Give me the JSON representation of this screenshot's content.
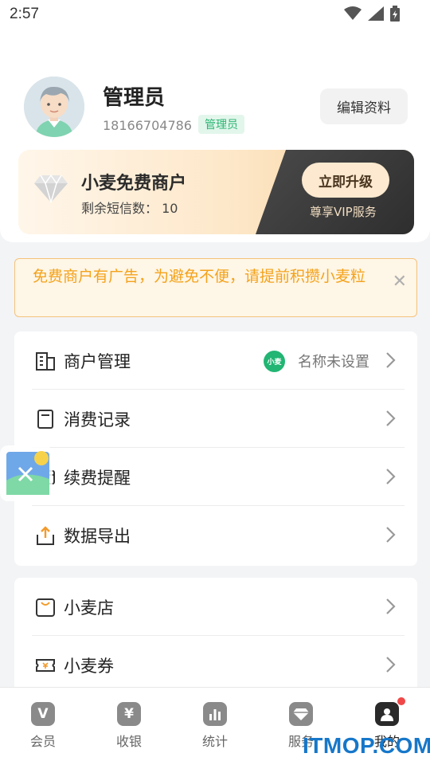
{
  "status_bar": {
    "time": "2:57"
  },
  "profile": {
    "name": "管理员",
    "phone": "18166704786",
    "role": "管理员",
    "edit_label": "编辑资料"
  },
  "vip": {
    "title": "小麦免费商户",
    "sms_label": "剩余短信数：",
    "sms_count": "10",
    "upgrade_label": "立即升级",
    "service_label": "尊享VIP服务"
  },
  "notice": {
    "text": "免费商户有广告，为避免不便，请提前积攒小麦粒"
  },
  "menu_group_1": [
    {
      "label": "商户管理",
      "value": "名称未设置",
      "logo_text": "小麦",
      "icon": "store-building-icon"
    },
    {
      "label": "消费记录",
      "icon": "receipt-icon"
    },
    {
      "label": "续费提醒",
      "icon": "card-icon"
    },
    {
      "label": "数据导出",
      "icon": "export-box-icon"
    }
  ],
  "menu_group_2": [
    {
      "label": "小麦店",
      "icon": "shop-bag-icon"
    },
    {
      "label": "小麦券",
      "icon": "coupon-icon"
    }
  ],
  "bottom_nav": [
    {
      "label": "会员",
      "icon": "vip-icon",
      "glyph": "V"
    },
    {
      "label": "收银",
      "icon": "cashier-yen-icon",
      "glyph": "¥"
    },
    {
      "label": "统计",
      "icon": "stats-icon",
      "glyph": ""
    },
    {
      "label": "服务",
      "icon": "diamond-icon",
      "glyph": ""
    },
    {
      "label": "我的",
      "icon": "profile-icon",
      "glyph": "",
      "active": true
    }
  ],
  "watermark": "ITMOP.COM",
  "colors": {
    "accent_green": "#2bb673",
    "notice_orange": "#f4a21b",
    "notice_bg": "#fef6e6"
  }
}
